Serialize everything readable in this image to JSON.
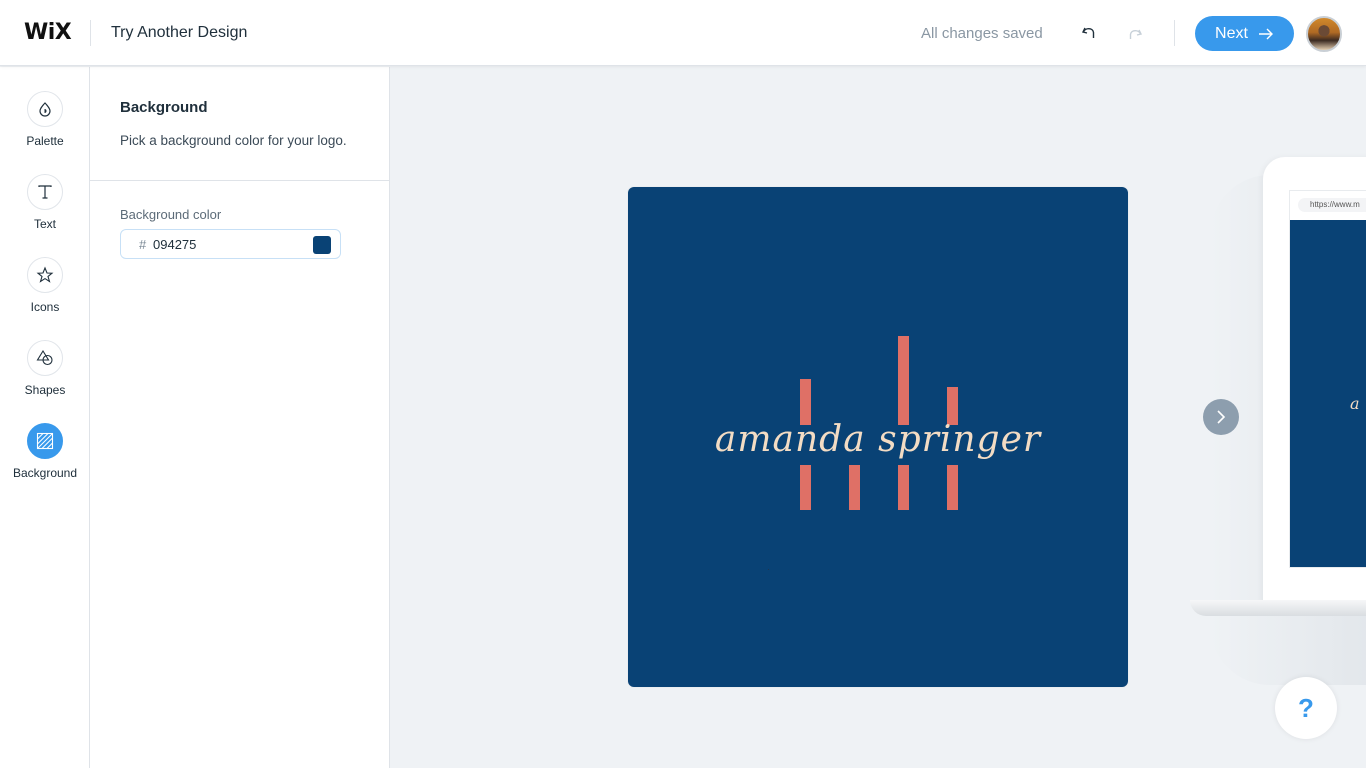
{
  "header": {
    "logo": "WiX",
    "title": "Try Another Design",
    "status": "All changes saved",
    "undo_icon": "undo-icon",
    "redo_icon": "redo-icon",
    "next_label": "Next",
    "next_icon": "arrow-right-icon",
    "avatar": "user-avatar"
  },
  "rail": {
    "items": [
      {
        "label": "Palette",
        "icon": "palette-drop-icon",
        "active": false
      },
      {
        "label": "Text",
        "icon": "text-icon",
        "active": false
      },
      {
        "label": "Icons",
        "icon": "star-icon",
        "active": false
      },
      {
        "label": "Shapes",
        "icon": "shapes-icon",
        "active": false
      },
      {
        "label": "Background",
        "icon": "background-hatch-icon",
        "active": true
      }
    ]
  },
  "panel": {
    "title": "Background",
    "description": "Pick a background color for your logo.",
    "field_label": "Background color",
    "hash": "#",
    "hex_value": "094275",
    "swatch_color": "#094275"
  },
  "canvas": {
    "brand_name": "amanda springer",
    "background_color": "#094275",
    "bar_color": "#df7066",
    "text_color": "#f3dcc4",
    "next_design_icon": "chevron-right-icon"
  },
  "mockup": {
    "url": "https://www.m",
    "preview_text": "a"
  },
  "help": {
    "label": "?"
  },
  "colors": {
    "accent": "#3899ec",
    "rail_active": "#3899ec"
  }
}
